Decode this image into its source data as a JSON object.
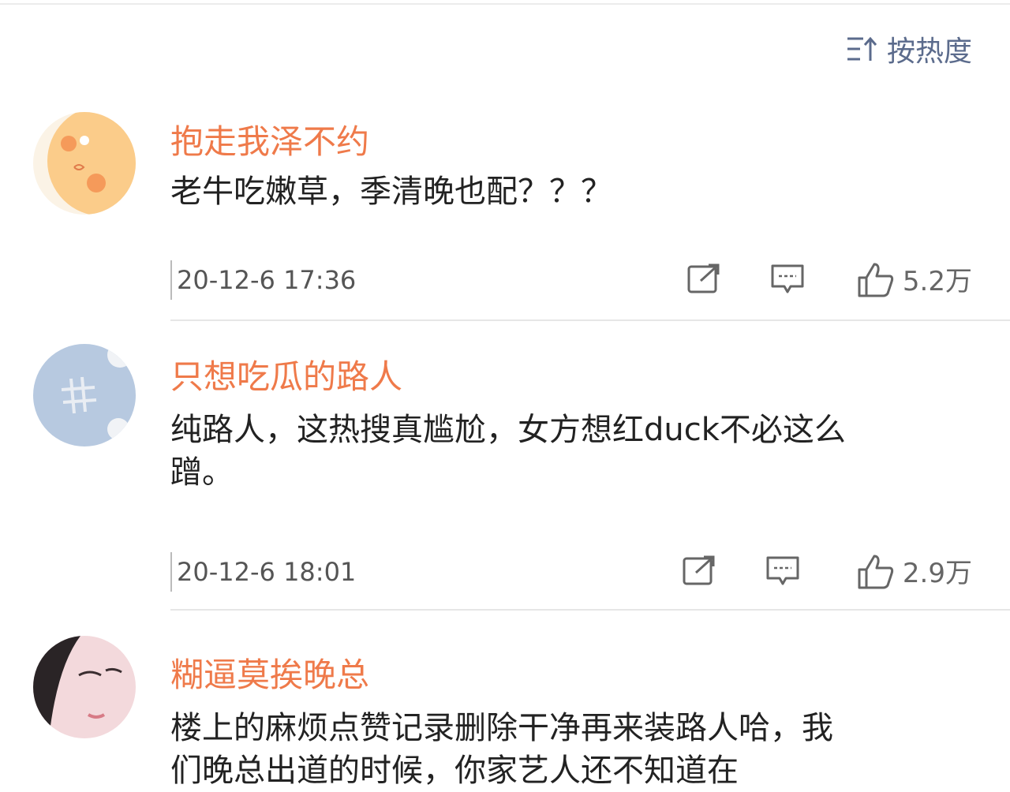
{
  "sort": {
    "label": "按热度",
    "icon": "sort-icon"
  },
  "comments": [
    {
      "username": "抱走我泽不约",
      "content": "老牛吃嫩草，季清晚也配？？？",
      "time": "20-12-6  17:36",
      "likes": "5.2万"
    },
    {
      "username": "只想吃瓜的路人",
      "content": "纯路人，这热搜真尴尬，女方想红duck不必这么蹭。",
      "time": "20-12-6  18:01",
      "likes": "2.9万"
    },
    {
      "username": "糊逼莫挨晚总",
      "content": "楼上的麻烦点赞记录删除干净再来装路人哈，我们晚总出道的时候，你家艺人还不知道在"
    }
  ],
  "icons": [
    "share-icon",
    "comment-icon",
    "thumbs-up-icon"
  ],
  "colors": {
    "username": "#ef7a4a",
    "sort": "#5b6b8c",
    "text": "#222222"
  }
}
